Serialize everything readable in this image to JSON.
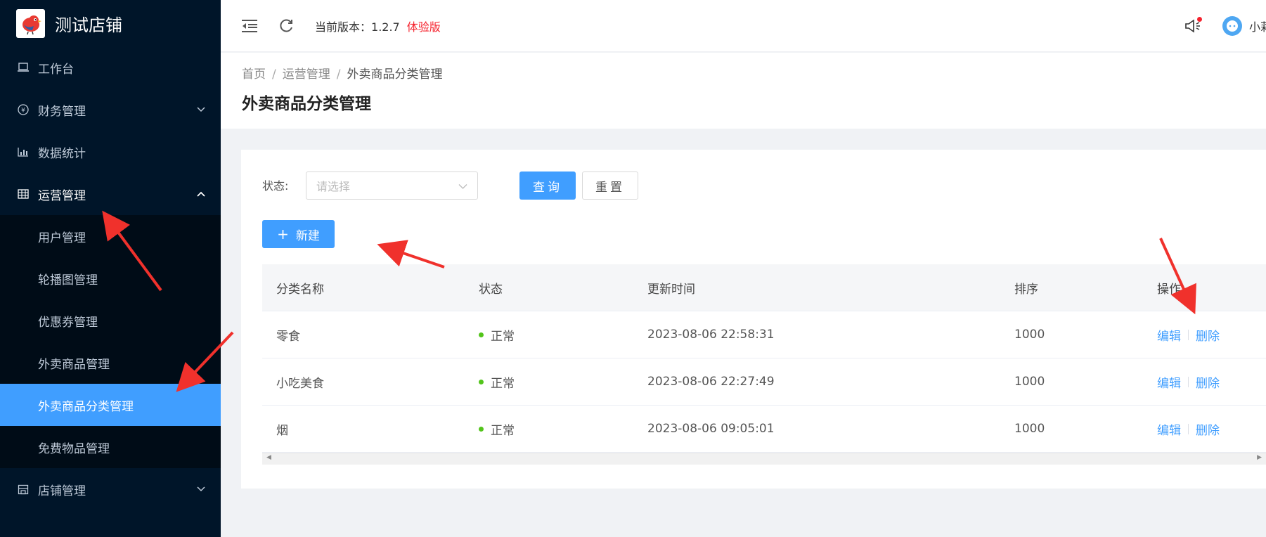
{
  "brand": {
    "name": "测试店铺",
    "logo_icon": "red-bird-logo"
  },
  "sidebar": {
    "items": [
      {
        "label": "工作台",
        "icon": "laptop-icon"
      },
      {
        "label": "财务管理",
        "icon": "yen-circle-icon"
      },
      {
        "label": "数据统计",
        "icon": "bar-chart-icon"
      },
      {
        "label": "运营管理",
        "icon": "table-icon"
      },
      {
        "label": "店铺管理",
        "icon": "store-icon"
      }
    ],
    "submenu": [
      {
        "label": "用户管理"
      },
      {
        "label": "轮播图管理"
      },
      {
        "label": "优惠券管理"
      },
      {
        "label": "外卖商品管理"
      },
      {
        "label": "外卖商品分类管理"
      },
      {
        "label": "免费物品管理"
      }
    ]
  },
  "header": {
    "version_label": "当前版本：",
    "version": "1.2.7",
    "trial": "体验版",
    "username": "小莉"
  },
  "breadcrumb": {
    "home": "首页",
    "sep": "/",
    "parent": "运营管理",
    "current": "外卖商品分类管理"
  },
  "page_title": "外卖商品分类管理",
  "filter": {
    "status_label": "状态:",
    "placeholder": "请选择",
    "query": "查询",
    "reset": "重置",
    "new": "新建"
  },
  "table": {
    "headers": [
      "分类名称",
      "状态",
      "更新时间",
      "排序",
      "操作"
    ],
    "rows": [
      {
        "name": "零食",
        "status": "正常",
        "updated": "2023-08-06 22:58:31",
        "sort": "1000"
      },
      {
        "name": "小吃美食",
        "status": "正常",
        "updated": "2023-08-06 22:27:49",
        "sort": "1000"
      },
      {
        "name": "烟",
        "status": "正常",
        "updated": "2023-08-06 09:05:01",
        "sort": "1000"
      }
    ],
    "edit": "编辑",
    "delete": "删除"
  },
  "colors": {
    "sidebar_bg": "#001529",
    "active": "#409eff",
    "trial": "#f5222d",
    "status_ok": "#52c41a",
    "annotation": "#f0312c"
  }
}
